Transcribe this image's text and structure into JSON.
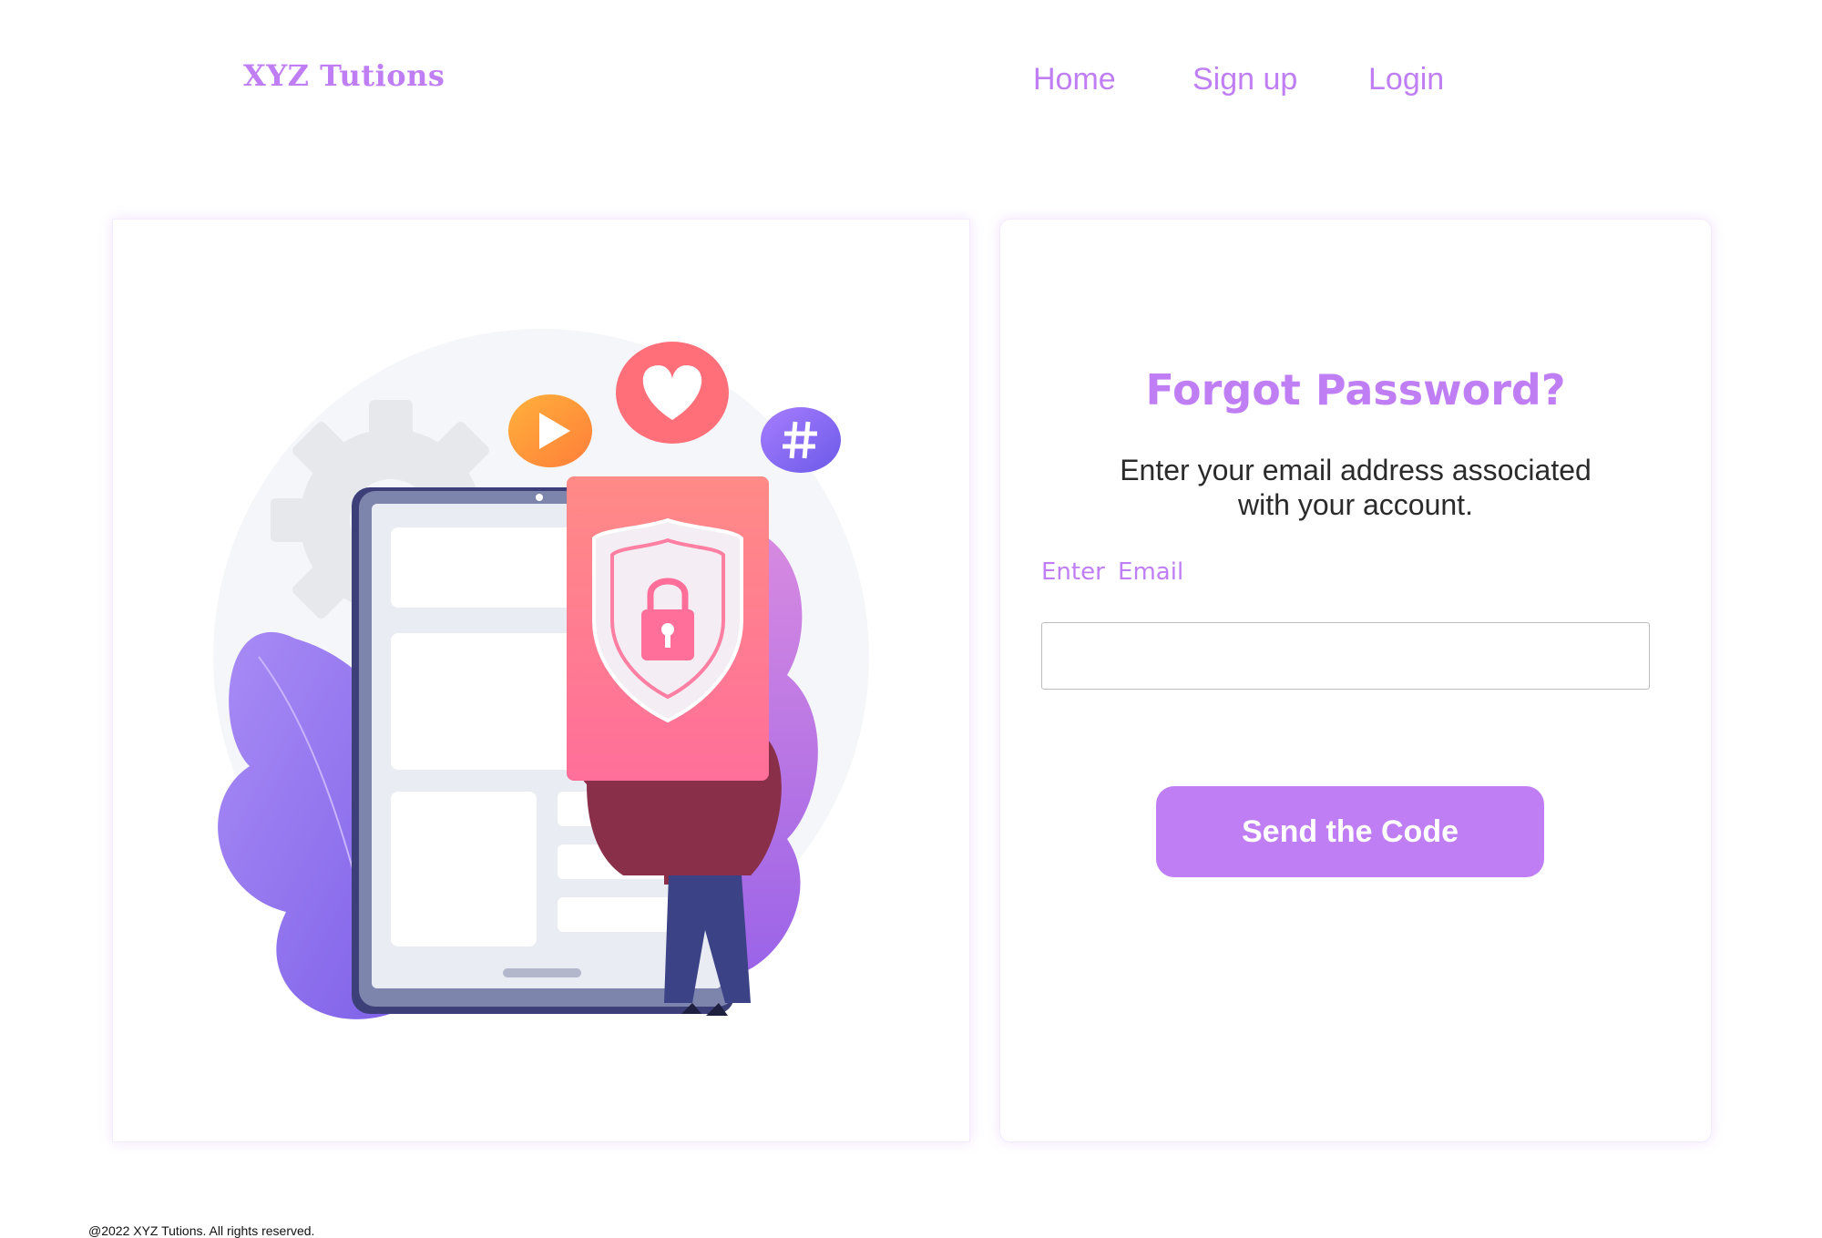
{
  "header": {
    "logo": "XYZ Tutions",
    "nav": [
      {
        "label": "Home"
      },
      {
        "label": "Sign up"
      },
      {
        "label": "Login"
      }
    ]
  },
  "form": {
    "title": "Forgot Password?",
    "subtitle": "Enter your email address associated with your account.",
    "email_label": "Enter  Email",
    "email_value": "",
    "email_placeholder": "",
    "submit_label": "Send the Code"
  },
  "footer": {
    "copyright": "@2022 XYZ Tutions. All rights reserved."
  },
  "colors": {
    "accent": "#c07ef5",
    "text": "#2b2b2b"
  },
  "illustration": {
    "icons": [
      "play-icon",
      "heart-icon",
      "hashtag-icon",
      "gear-icon",
      "padlock-icon",
      "shield-icon"
    ]
  }
}
